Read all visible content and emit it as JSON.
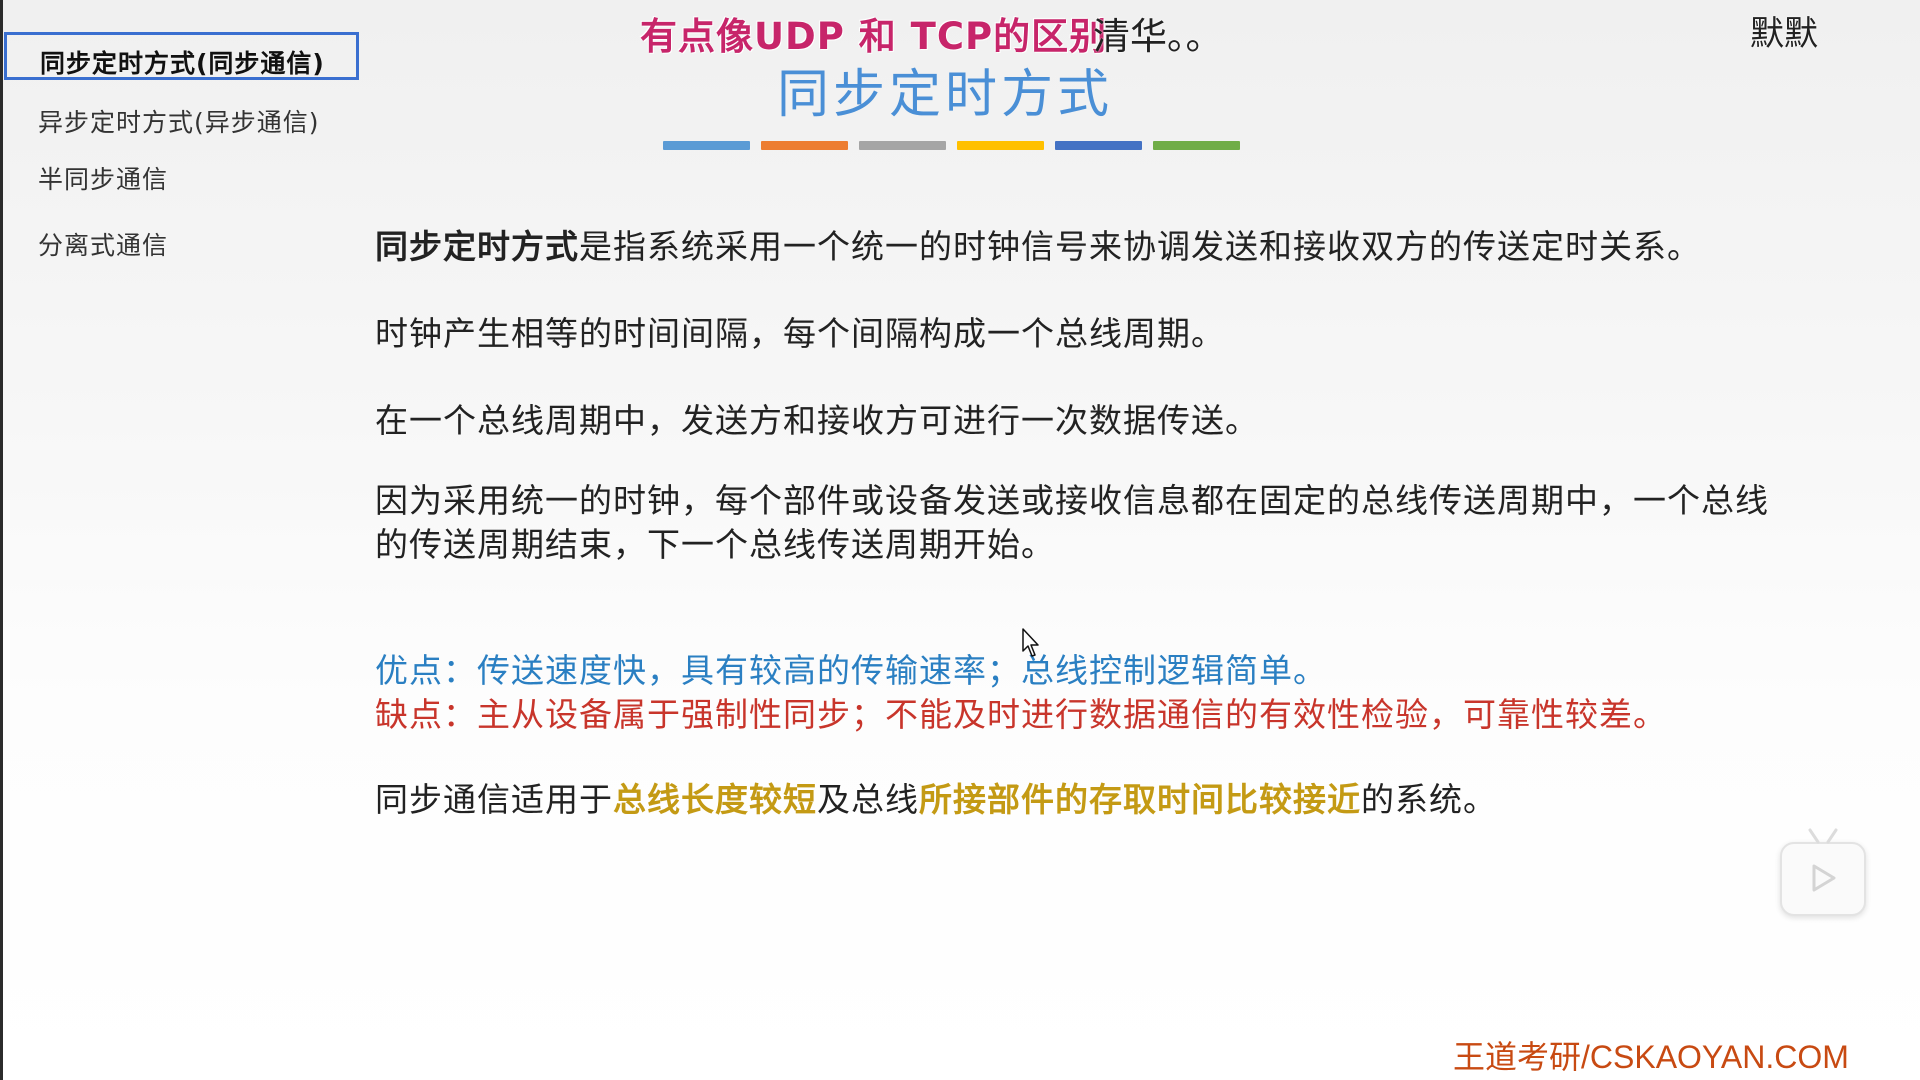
{
  "overlay": {
    "danmaku_1": "有点像UDP 和 TCP的区别",
    "danmaku_2": "清华。。",
    "username": "默默"
  },
  "sidebar": {
    "items": [
      {
        "label": "同步定时方式(同步通信)",
        "active": true
      },
      {
        "label": "异步定时方式(异步通信)",
        "active": false
      },
      {
        "label": "半同步通信",
        "active": false
      },
      {
        "label": "分离式通信",
        "active": false
      }
    ]
  },
  "slide": {
    "title": "同步定时方式",
    "color_bars": [
      "#5b9bd5",
      "#ed7d31",
      "#a5a5a5",
      "#ffc000",
      "#4472c4",
      "#70ad47"
    ],
    "definition_term": "同步定时方式",
    "definition_rest": "是指系统采用一个统一的时钟信号来协调发送和接收双方的传送定时关系。",
    "para_2": "时钟产生相等的时间间隔，每个间隔构成一个总线周期。",
    "para_3": "在一个总线周期中，发送方和接收方可进行一次数据传送。",
    "para_4": "因为采用统一的时钟，每个部件或设备发送或接收信息都在固定的总线传送周期中，一个总线的传送周期结束，下一个总线传送周期开始。",
    "advantage": "优点：传送速度快，具有较高的传输速率；总线控制逻辑简单。",
    "disadvantage": "缺点：主从设备属于强制性同步；不能及时进行数据通信的有效性检验，可靠性较差。",
    "usage_prefix": "同步通信适用于",
    "usage_highlight_1": "总线长度较短",
    "usage_middle": "及总线",
    "usage_highlight_2": "所接部件的存取时间比较接近",
    "usage_suffix": "的系统。"
  },
  "watermark": "王道考研/CSKAOYAN.COM",
  "colors": {
    "title_blue": "#4a8fd6",
    "advantage_blue": "#2a7fc2",
    "disadvantage_red": "#c8352b",
    "highlight_gold": "#c49a14",
    "danmaku_pink": "#c7256a",
    "active_border": "#3a6fd0"
  },
  "icons": {
    "cursor": "mouse-pointer-icon",
    "play": "play-icon"
  }
}
